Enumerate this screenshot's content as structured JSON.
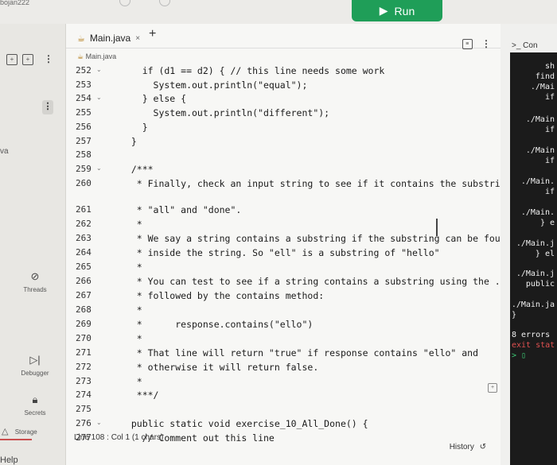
{
  "topbar": {
    "crumb": "bojan222",
    "run_label": "Run"
  },
  "leftbar": {
    "partial_label": "va",
    "tools": [
      "Threads",
      "Debugger",
      "Secrets"
    ],
    "storage": "Storage",
    "help": "Help"
  },
  "editor": {
    "tab_label": "Main.java",
    "tab_close": "×",
    "add_tab": "+",
    "file_path": "Main.java",
    "status_left": "Line 108 : Col 1 (1 chars)",
    "status_right": "History",
    "lines": [
      {
        "n": "252",
        "fold": true,
        "text": "    if (d1 == d2) { // this line needs some work"
      },
      {
        "n": "253",
        "fold": false,
        "text": "      System.out.println(\"equal\");"
      },
      {
        "n": "254",
        "fold": true,
        "text": "    } else {"
      },
      {
        "n": "255",
        "fold": false,
        "text": "      System.out.println(\"different\");"
      },
      {
        "n": "256",
        "fold": false,
        "text": "    }"
      },
      {
        "n": "257",
        "fold": false,
        "text": "  }"
      },
      {
        "n": "258",
        "fold": false,
        "text": ""
      },
      {
        "n": "259",
        "fold": true,
        "text": "  /***"
      },
      {
        "n": "260",
        "fold": false,
        "text": "   * Finally, check an input string to see if it contains the substring"
      },
      {
        "n": "261",
        "fold": false,
        "text": "   * \"all\" and \"done\"."
      },
      {
        "n": "262",
        "fold": false,
        "text": "   *"
      },
      {
        "n": "263",
        "fold": false,
        "text": "   * We say a string contains a substring if the substring can be found"
      },
      {
        "n": "264",
        "fold": false,
        "text": "   * inside the string. So \"ell\" is a substring of \"hello\""
      },
      {
        "n": "265",
        "fold": false,
        "text": "   *"
      },
      {
        "n": "266",
        "fold": false,
        "text": "   * You can test to see if a string contains a substring using the ."
      },
      {
        "n": "267",
        "fold": false,
        "text": "   * followed by the contains method:"
      },
      {
        "n": "268",
        "fold": false,
        "text": "   *"
      },
      {
        "n": "269",
        "fold": false,
        "text": "   *      response.contains(\"ello\")"
      },
      {
        "n": "270",
        "fold": false,
        "text": "   *"
      },
      {
        "n": "271",
        "fold": false,
        "text": "   * That line will return \"true\" if response contains \"ello\" and"
      },
      {
        "n": "272",
        "fold": false,
        "text": "   * otherwise it will return false."
      },
      {
        "n": "273",
        "fold": false,
        "text": "   *"
      },
      {
        "n": "274",
        "fold": false,
        "text": "   ***/"
      },
      {
        "n": "275",
        "fold": false,
        "text": ""
      },
      {
        "n": "276",
        "fold": true,
        "text": "  public static void exercise_10_All_Done() {"
      },
      {
        "n": "277",
        "fold": false,
        "text": "    // Comment out this line"
      }
    ]
  },
  "console": {
    "tab_label": ">_ Con",
    "lines": [
      {
        "text": "sh",
        "cls": ""
      },
      {
        "text": "find",
        "cls": ""
      },
      {
        "text": "./Mai",
        "cls": ""
      },
      {
        "text": "if",
        "cls": ""
      },
      {
        "text": "./Main",
        "cls": ""
      },
      {
        "text": "if",
        "cls": ""
      },
      {
        "text": "./Main",
        "cls": ""
      },
      {
        "text": "if",
        "cls": ""
      },
      {
        "text": "./Main.",
        "cls": ""
      },
      {
        "text": "if",
        "cls": ""
      },
      {
        "text": "./Main.",
        "cls": ""
      },
      {
        "text": "} e",
        "cls": ""
      },
      {
        "text": "./Main.j",
        "cls": ""
      },
      {
        "text": "} el",
        "cls": ""
      },
      {
        "text": "./Main.j",
        "cls": ""
      },
      {
        "text": "public",
        "cls": ""
      },
      {
        "text": "./Main.ja",
        "cls": ""
      },
      {
        "text": "}",
        "cls": "l"
      },
      {
        "text": "8 errors",
        "cls": "l"
      },
      {
        "text": "exit stat",
        "cls": "l red"
      },
      {
        "text": "> ▯",
        "cls": "l green"
      }
    ]
  }
}
